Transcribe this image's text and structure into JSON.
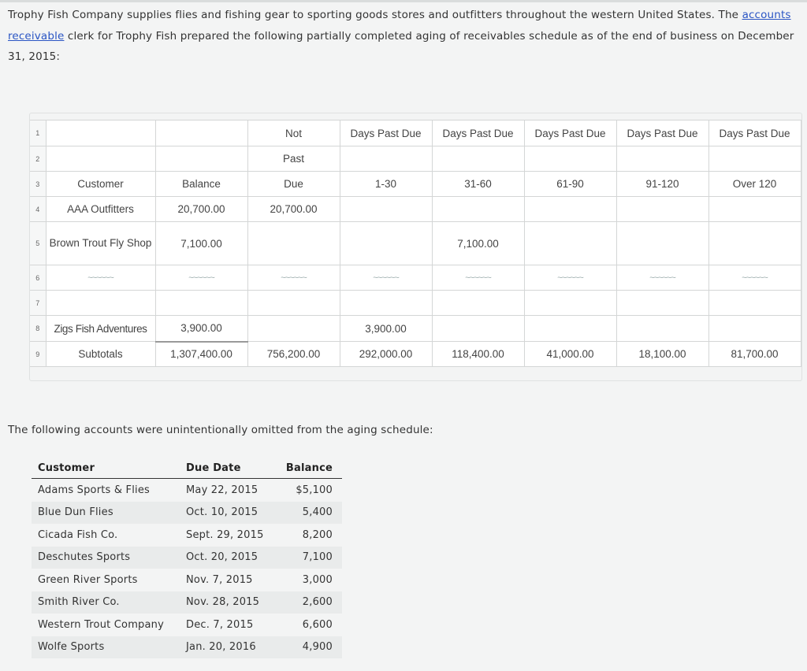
{
  "intro": {
    "text_before": "Trophy Fish Company supplies flies and fishing gear to sporting goods stores and outfitters throughout the western United States. The ",
    "link_text": "accounts receivable",
    "text_after": " clerk for Trophy Fish prepared the following partially completed aging of receivables schedule as of the end of business on December 31, 2015:"
  },
  "sheet": {
    "row_numbers": [
      "1",
      "2",
      "3",
      "4",
      "5",
      "6",
      "7",
      "8",
      "9"
    ],
    "header_row1": [
      "",
      "",
      "Not",
      "Days Past Due",
      "Days Past Due",
      "Days Past Due",
      "Days Past Due",
      "Days Past Due"
    ],
    "header_row2": [
      "",
      "",
      "Past",
      "",
      "",
      "",
      "",
      ""
    ],
    "header_row3": [
      "Customer",
      "Balance",
      "Due",
      "1-30",
      "31-60",
      "61-90",
      "91-120",
      "Over 120"
    ],
    "rows": [
      {
        "customer": "AAA Outfitters",
        "balance": "20,700.00",
        "not_past_due": "20,700.00",
        "d1_30": "",
        "d31_60": "",
        "d61_90": "",
        "d91_120": "",
        "over120": ""
      },
      {
        "customer": "Brown Trout Fly Shop",
        "balance": "7,100.00",
        "not_past_due": "",
        "d1_30": "",
        "d31_60": "7,100.00",
        "d61_90": "",
        "d91_120": "",
        "over120": ""
      },
      {
        "customer": "~~~~~~",
        "balance": "~~~~~~",
        "not_past_due": "~~~~~~",
        "d1_30": "~~~~~~",
        "d31_60": "~~~~~~",
        "d61_90": "~~~~~~",
        "d91_120": "~~~~~~",
        "over120": "~~~~~~"
      },
      {
        "customer": "",
        "balance": "",
        "not_past_due": "",
        "d1_30": "",
        "d31_60": "",
        "d61_90": "",
        "d91_120": "",
        "over120": ""
      },
      {
        "customer": "Zigs Fish Adventures",
        "balance": "3,900.00",
        "not_past_due": "",
        "d1_30": "3,900.00",
        "d31_60": "",
        "d61_90": "",
        "d91_120": "",
        "over120": ""
      }
    ],
    "subtotals": {
      "label": "Subtotals",
      "balance": "1,307,400.00",
      "not_past_due": "756,200.00",
      "d1_30": "292,000.00",
      "d31_60": "118,400.00",
      "d61_90": "41,000.00",
      "d91_120": "18,100.00",
      "over120": "81,700.00"
    }
  },
  "omitted_note": "The following accounts were unintentionally omitted from the aging schedule:",
  "omitted": {
    "headers": {
      "customer": "Customer",
      "due_date": "Due Date",
      "balance": "Balance"
    },
    "rows": [
      {
        "customer": "Adams Sports & Flies",
        "due_date": "May 22, 2015",
        "balance": "$5,100"
      },
      {
        "customer": "Blue Dun Flies",
        "due_date": "Oct. 10, 2015",
        "balance": "5,400"
      },
      {
        "customer": "Cicada Fish Co.",
        "due_date": "Sept. 29, 2015",
        "balance": "8,200"
      },
      {
        "customer": "Deschutes Sports",
        "due_date": "Oct. 20, 2015",
        "balance": "7,100"
      },
      {
        "customer": "Green River Sports",
        "due_date": "Nov. 7, 2015",
        "balance": "3,000"
      },
      {
        "customer": "Smith River Co.",
        "due_date": "Nov. 28, 2015",
        "balance": "2,600"
      },
      {
        "customer": "Western Trout Company",
        "due_date": "Dec. 7, 2015",
        "balance": "6,600"
      },
      {
        "customer": "Wolfe Sports",
        "due_date": "Jan. 20, 2016",
        "balance": "4,900"
      }
    ]
  }
}
